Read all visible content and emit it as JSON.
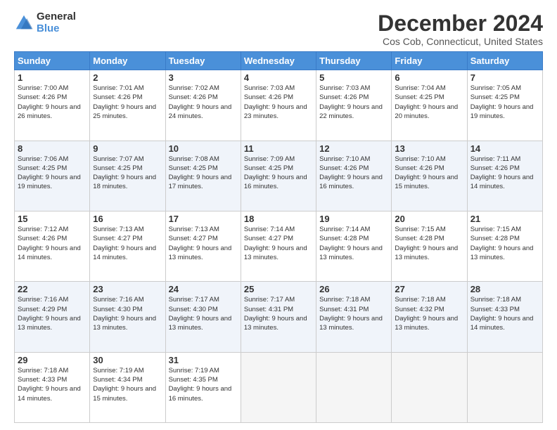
{
  "logo": {
    "general": "General",
    "blue": "Blue"
  },
  "title": "December 2024",
  "subtitle": "Cos Cob, Connecticut, United States",
  "weekdays": [
    "Sunday",
    "Monday",
    "Tuesday",
    "Wednesday",
    "Thursday",
    "Friday",
    "Saturday"
  ],
  "weeks": [
    [
      {
        "day": 1,
        "sunrise": "7:00 AM",
        "sunset": "4:26 PM",
        "daylight": "9 hours and 26 minutes."
      },
      {
        "day": 2,
        "sunrise": "7:01 AM",
        "sunset": "4:26 PM",
        "daylight": "9 hours and 25 minutes."
      },
      {
        "day": 3,
        "sunrise": "7:02 AM",
        "sunset": "4:26 PM",
        "daylight": "9 hours and 24 minutes."
      },
      {
        "day": 4,
        "sunrise": "7:03 AM",
        "sunset": "4:26 PM",
        "daylight": "9 hours and 23 minutes."
      },
      {
        "day": 5,
        "sunrise": "7:03 AM",
        "sunset": "4:26 PM",
        "daylight": "9 hours and 22 minutes."
      },
      {
        "day": 6,
        "sunrise": "7:04 AM",
        "sunset": "4:25 PM",
        "daylight": "9 hours and 20 minutes."
      },
      {
        "day": 7,
        "sunrise": "7:05 AM",
        "sunset": "4:25 PM",
        "daylight": "9 hours and 19 minutes."
      }
    ],
    [
      {
        "day": 8,
        "sunrise": "7:06 AM",
        "sunset": "4:25 PM",
        "daylight": "9 hours and 19 minutes."
      },
      {
        "day": 9,
        "sunrise": "7:07 AM",
        "sunset": "4:25 PM",
        "daylight": "9 hours and 18 minutes."
      },
      {
        "day": 10,
        "sunrise": "7:08 AM",
        "sunset": "4:25 PM",
        "daylight": "9 hours and 17 minutes."
      },
      {
        "day": 11,
        "sunrise": "7:09 AM",
        "sunset": "4:25 PM",
        "daylight": "9 hours and 16 minutes."
      },
      {
        "day": 12,
        "sunrise": "7:10 AM",
        "sunset": "4:26 PM",
        "daylight": "9 hours and 16 minutes."
      },
      {
        "day": 13,
        "sunrise": "7:10 AM",
        "sunset": "4:26 PM",
        "daylight": "9 hours and 15 minutes."
      },
      {
        "day": 14,
        "sunrise": "7:11 AM",
        "sunset": "4:26 PM",
        "daylight": "9 hours and 14 minutes."
      }
    ],
    [
      {
        "day": 15,
        "sunrise": "7:12 AM",
        "sunset": "4:26 PM",
        "daylight": "9 hours and 14 minutes."
      },
      {
        "day": 16,
        "sunrise": "7:13 AM",
        "sunset": "4:27 PM",
        "daylight": "9 hours and 14 minutes."
      },
      {
        "day": 17,
        "sunrise": "7:13 AM",
        "sunset": "4:27 PM",
        "daylight": "9 hours and 13 minutes."
      },
      {
        "day": 18,
        "sunrise": "7:14 AM",
        "sunset": "4:27 PM",
        "daylight": "9 hours and 13 minutes."
      },
      {
        "day": 19,
        "sunrise": "7:14 AM",
        "sunset": "4:28 PM",
        "daylight": "9 hours and 13 minutes."
      },
      {
        "day": 20,
        "sunrise": "7:15 AM",
        "sunset": "4:28 PM",
        "daylight": "9 hours and 13 minutes."
      },
      {
        "day": 21,
        "sunrise": "7:15 AM",
        "sunset": "4:28 PM",
        "daylight": "9 hours and 13 minutes."
      }
    ],
    [
      {
        "day": 22,
        "sunrise": "7:16 AM",
        "sunset": "4:29 PM",
        "daylight": "9 hours and 13 minutes."
      },
      {
        "day": 23,
        "sunrise": "7:16 AM",
        "sunset": "4:30 PM",
        "daylight": "9 hours and 13 minutes."
      },
      {
        "day": 24,
        "sunrise": "7:17 AM",
        "sunset": "4:30 PM",
        "daylight": "9 hours and 13 minutes."
      },
      {
        "day": 25,
        "sunrise": "7:17 AM",
        "sunset": "4:31 PM",
        "daylight": "9 hours and 13 minutes."
      },
      {
        "day": 26,
        "sunrise": "7:18 AM",
        "sunset": "4:31 PM",
        "daylight": "9 hours and 13 minutes."
      },
      {
        "day": 27,
        "sunrise": "7:18 AM",
        "sunset": "4:32 PM",
        "daylight": "9 hours and 13 minutes."
      },
      {
        "day": 28,
        "sunrise": "7:18 AM",
        "sunset": "4:33 PM",
        "daylight": "9 hours and 14 minutes."
      }
    ],
    [
      {
        "day": 29,
        "sunrise": "7:18 AM",
        "sunset": "4:33 PM",
        "daylight": "9 hours and 14 minutes."
      },
      {
        "day": 30,
        "sunrise": "7:19 AM",
        "sunset": "4:34 PM",
        "daylight": "9 hours and 15 minutes."
      },
      {
        "day": 31,
        "sunrise": "7:19 AM",
        "sunset": "4:35 PM",
        "daylight": "9 hours and 16 minutes."
      },
      null,
      null,
      null,
      null
    ]
  ],
  "labels": {
    "sunrise": "Sunrise:",
    "sunset": "Sunset:",
    "daylight": "Daylight:"
  }
}
